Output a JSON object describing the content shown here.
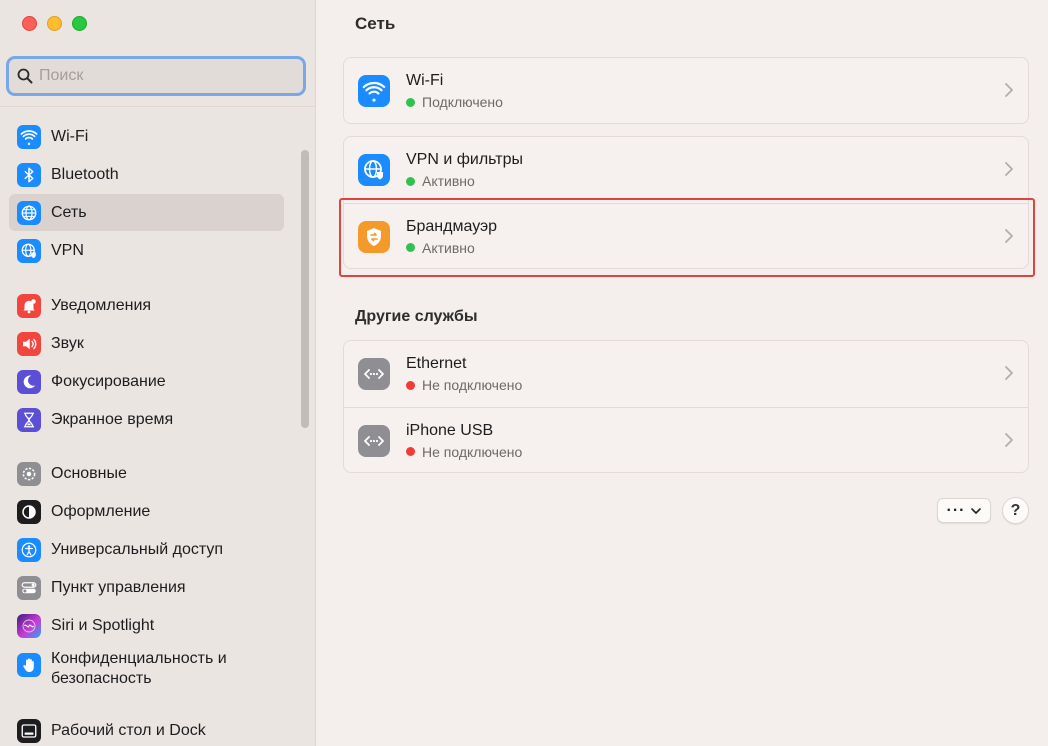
{
  "window": {
    "title": "Сеть"
  },
  "search": {
    "placeholder": "Поиск"
  },
  "sidebar": {
    "items": [
      {
        "label": "Wi-Fi",
        "icon": "wifi-icon",
        "color": "#1a8cff"
      },
      {
        "label": "Bluetooth",
        "icon": "bluetooth-icon",
        "color": "#1a8cff"
      },
      {
        "label": "Сеть",
        "icon": "globe-icon",
        "color": "#1a8cff"
      },
      {
        "label": "VPN",
        "icon": "vpn-globe-icon",
        "color": "#1a8cff"
      },
      {
        "label": "Уведомления",
        "icon": "bell-icon",
        "color": "#f2453d"
      },
      {
        "label": "Звук",
        "icon": "speaker-icon",
        "color": "#f2453d"
      },
      {
        "label": "Фокусирование",
        "icon": "moon-icon",
        "color": "#5b4fd6"
      },
      {
        "label": "Экранное время",
        "icon": "hourglass-icon",
        "color": "#5b4fd6"
      },
      {
        "label": "Основные",
        "icon": "gear-icon",
        "color": "#8e8e93"
      },
      {
        "label": "Оформление",
        "icon": "appearance-icon",
        "color": "#1d1d1f"
      },
      {
        "label": "Универсальный доступ",
        "icon": "accessibility-icon",
        "color": "#1a8cff"
      },
      {
        "label": "Пункт управления",
        "icon": "control-center-icon",
        "color": "#8e8e93"
      },
      {
        "label": "Siri и Spotlight",
        "icon": "siri-icon",
        "color": "#6a3fc7"
      },
      {
        "label": "Конфиденциальность и безопасность",
        "icon": "hand-icon",
        "color": "#1a8cff"
      },
      {
        "label": "Рабочий стол и Dock",
        "icon": "dock-icon",
        "color": "#1d1d1f"
      }
    ]
  },
  "main": {
    "services": [
      {
        "title": "Wi-Fi",
        "status": "Подключено",
        "status_color": "#30c24a",
        "icon": "wifi-icon",
        "icon_bg": "#1a8cff"
      },
      {
        "title": "VPN и фильтры",
        "status": "Активно",
        "status_color": "#30c24a",
        "icon": "vpn-globe-icon",
        "icon_bg": "#1a8cff"
      },
      {
        "title": "Брандмауэр",
        "status": "Активно",
        "status_color": "#30c24a",
        "icon": "firewall-icon",
        "icon_bg": "#f49a2a"
      }
    ],
    "other_label": "Другие службы",
    "other_services": [
      {
        "title": "Ethernet",
        "status": "Не подключено",
        "status_color": "#f23b35",
        "icon": "ethernet-icon",
        "icon_bg": "#8e8e93"
      },
      {
        "title": "iPhone USB",
        "status": "Не подключено",
        "status_color": "#f23b35",
        "icon": "ethernet-icon",
        "icon_bg": "#8e8e93"
      }
    ],
    "more_button": "···",
    "help_button": "?"
  }
}
